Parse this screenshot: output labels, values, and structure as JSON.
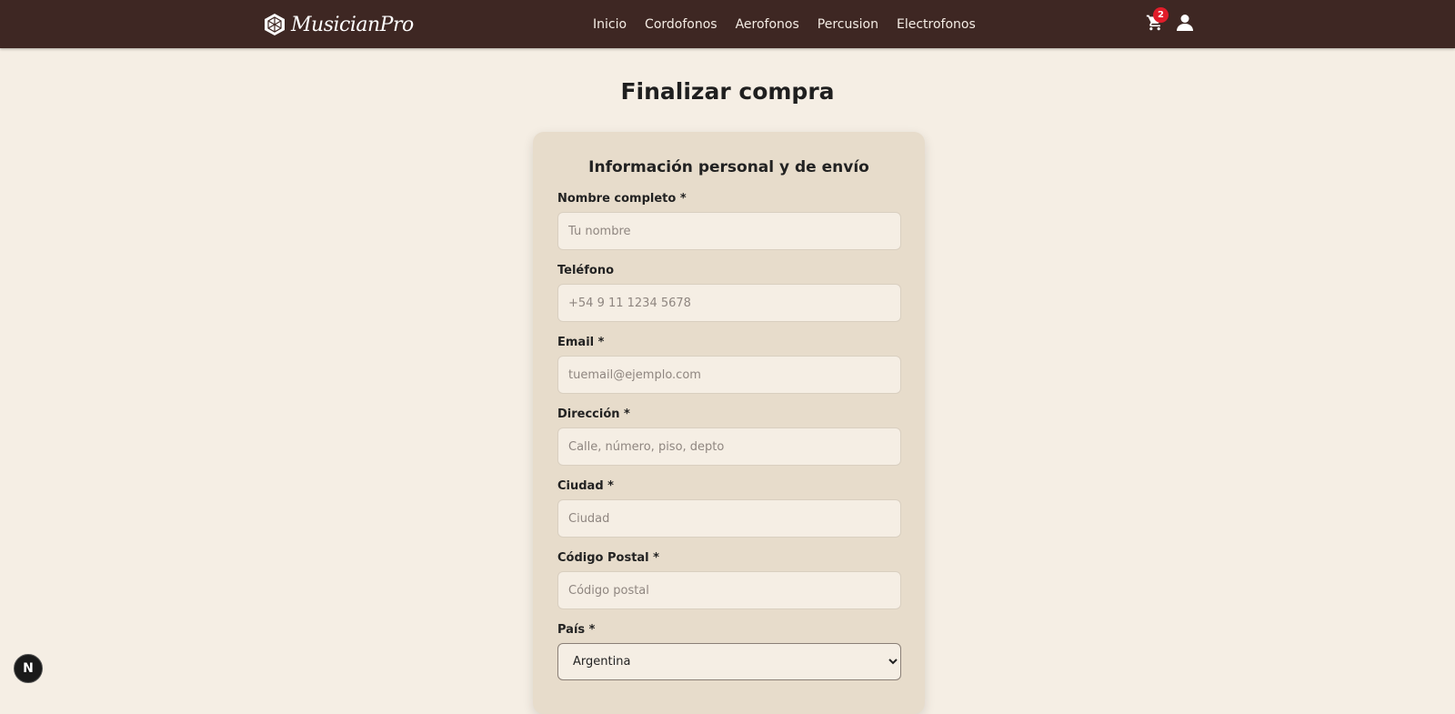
{
  "navbar": {
    "brand": "MusicianPro",
    "links": [
      "Inicio",
      "Cordofonos",
      "Aerofonos",
      "Percusion",
      "Electrofonos"
    ],
    "cart_count": "2",
    "cart_icon": "cart-icon",
    "user_icon": "user-icon"
  },
  "page": {
    "title": "Finalizar compra"
  },
  "form": {
    "title": "Información personal y de envío",
    "fields": [
      {
        "label": "Nombre completo *",
        "placeholder": "Tu nombre",
        "value": ""
      },
      {
        "label": "Teléfono",
        "placeholder": "+54 9 11 1234 5678",
        "value": ""
      },
      {
        "label": "Email *",
        "placeholder": "tuemail@ejemplo.com",
        "value": ""
      },
      {
        "label": "Dirección *",
        "placeholder": "Calle, número, piso, depto",
        "value": ""
      },
      {
        "label": "Ciudad *",
        "placeholder": "Ciudad",
        "value": ""
      },
      {
        "label": "Código Postal *",
        "placeholder": "Código postal",
        "value": ""
      }
    ],
    "country": {
      "label": "País *",
      "selected": "Argentina"
    }
  },
  "dev_badge": {
    "label": "N"
  },
  "colors": {
    "navbar": "#3e2723",
    "background": "#f5eee4",
    "card": "#e7dccb",
    "badge": "#e11d2a"
  }
}
